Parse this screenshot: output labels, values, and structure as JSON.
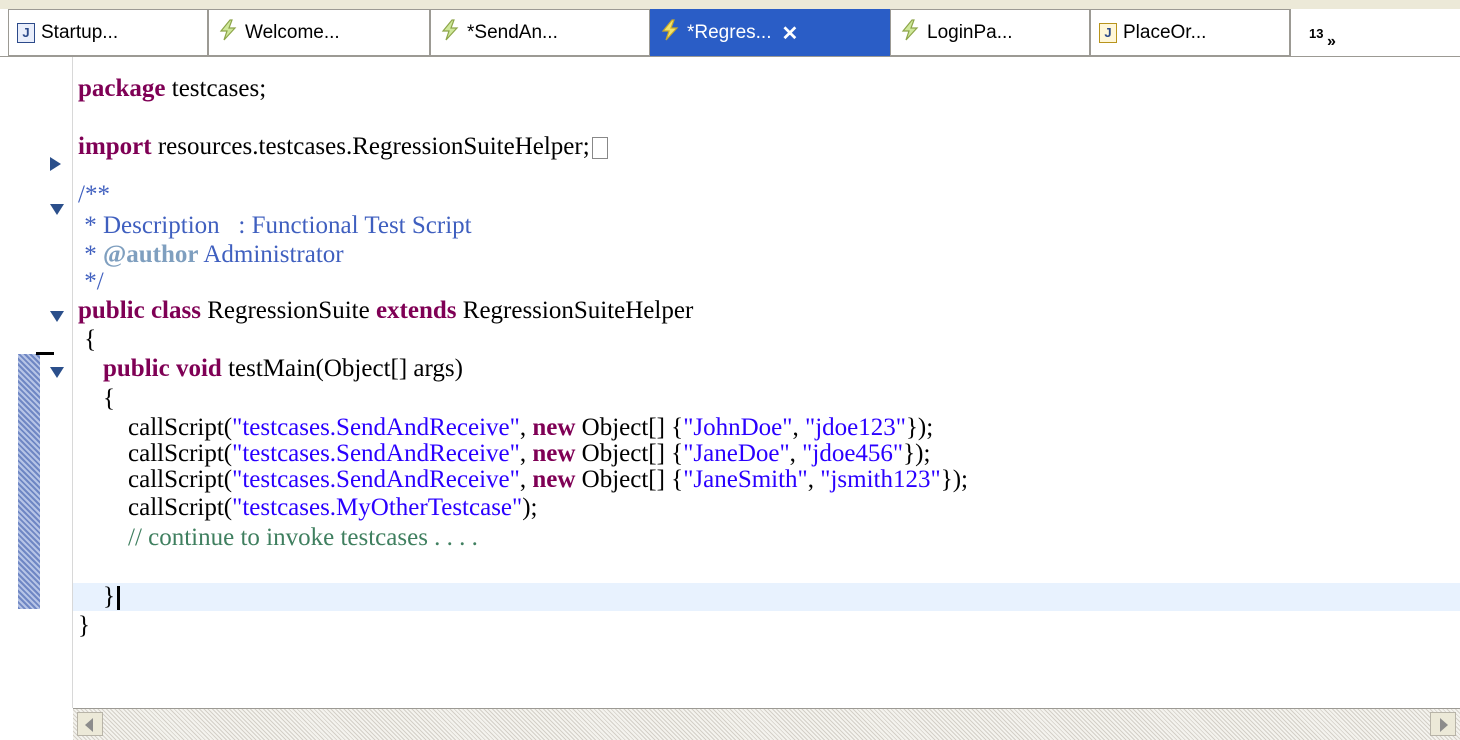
{
  "tabs": [
    {
      "label": "Startup...",
      "icon": "java-file-icon",
      "active": false
    },
    {
      "label": "Welcome...",
      "icon": "script-lightning-icon",
      "active": false
    },
    {
      "label": "*SendAn...",
      "icon": "script-lightning-icon",
      "active": false
    },
    {
      "label": "*Regres...",
      "icon": "script-lightning-icon",
      "active": true
    },
    {
      "label": "LoginPa...",
      "icon": "script-lightning-icon",
      "active": false
    },
    {
      "label": "PlaceOr...",
      "icon": "java-file-warning-icon",
      "active": false
    }
  ],
  "overflow": {
    "label": "»",
    "count": "13"
  },
  "code": {
    "package_kw": "package",
    "package_name": " testcases;",
    "import_kw": "import",
    "import_name": " resources.testcases.RegressionSuiteHelper;",
    "doc_open": "/**",
    "doc_desc": " * Description   : Functional Test Script",
    "doc_author_prefix": " * ",
    "doc_author_tag": "@author",
    "doc_author_name": " Administrator",
    "doc_close": " */",
    "class_public": "public",
    "class_class": "class",
    "class_name": " RegressionSuite ",
    "class_extends": "extends",
    "class_super": " RegressionSuiteHelper",
    "open_brace": " {",
    "method_public": "public",
    "method_void": "void",
    "method_sig": " testMain(Object[] args)",
    "method_open": "{",
    "calls": [
      {
        "fn": "callScript(",
        "arg": "\"testcases.SendAndReceive\"",
        "sep": ", ",
        "kw": "new",
        "obj": " Object[] {",
        "a1": "\"JohnDoe\"",
        "c": ", ",
        "a2": "\"jdoe123\"",
        "end": "});"
      },
      {
        "fn": "callScript(",
        "arg": "\"testcases.SendAndReceive\"",
        "sep": ", ",
        "kw": "new",
        "obj": " Object[] {",
        "a1": "\"JaneDoe\"",
        "c": ", ",
        "a2": "\"jdoe456\"",
        "end": "});"
      },
      {
        "fn": "callScript(",
        "arg": "\"testcases.SendAndReceive\"",
        "sep": ", ",
        "kw": "new",
        "obj": " Object[] {",
        "a1": "\"JaneSmith\"",
        "c": ", ",
        "a2": "\"jsmith123\"",
        "end": "});"
      }
    ],
    "last_call_fn": "callScript(",
    "last_call_arg": "\"testcases.MyOtherTestcase\"",
    "last_call_end": ");",
    "comment": "// continue to invoke testcases . . . .",
    "method_close": "}",
    "class_close": "}"
  },
  "colors": {
    "keyword": "#7f0055",
    "string": "#2a00ff",
    "javadoc": "#3f5fbf",
    "line_comment": "#3f7f5f",
    "active_tab": "#2a5dc6"
  }
}
